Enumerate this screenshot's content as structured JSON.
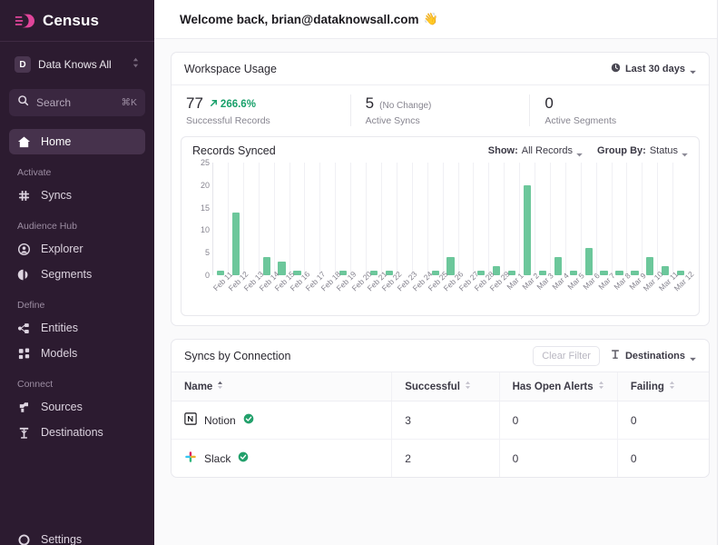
{
  "sidebar": {
    "brand": {
      "name": "Census",
      "logo_icon": "census-logo-icon",
      "color": "#e0459a"
    },
    "workspace": {
      "initial": "D",
      "name": "Data Knows All"
    },
    "search": {
      "placeholder": "Search",
      "shortcut": "⌘K"
    },
    "home": {
      "label": "Home",
      "icon": "home-icon"
    },
    "groups": [
      {
        "title": "Activate",
        "items": [
          {
            "label": "Syncs",
            "icon": "syncs-icon"
          }
        ]
      },
      {
        "title": "Audience Hub",
        "items": [
          {
            "label": "Explorer",
            "icon": "explorer-icon"
          },
          {
            "label": "Segments",
            "icon": "segments-icon"
          }
        ]
      },
      {
        "title": "Define",
        "items": [
          {
            "label": "Entities",
            "icon": "entities-icon"
          },
          {
            "label": "Models",
            "icon": "models-icon"
          }
        ]
      },
      {
        "title": "Connect",
        "items": [
          {
            "label": "Sources",
            "icon": "sources-icon"
          },
          {
            "label": "Destinations",
            "icon": "destinations-icon"
          }
        ]
      }
    ],
    "settings": {
      "label": "Settings",
      "icon": "gear-icon"
    }
  },
  "header": {
    "welcome": "Welcome back, brian@dataknowsall.com",
    "wave_emoji": "👋"
  },
  "workspace_usage": {
    "title": "Workspace Usage",
    "range": {
      "label": "Last 30 days",
      "icon": "clock-icon"
    },
    "stats": [
      {
        "value": "77",
        "delta": "266.6%",
        "delta_icon": "arrow-up-right-icon",
        "delta_color": "#18a06a",
        "note": "",
        "label": "Successful Records"
      },
      {
        "value": "5",
        "delta": "",
        "note": "(No Change)",
        "label": "Active Syncs"
      },
      {
        "value": "0",
        "delta": "",
        "note": "",
        "label": "Active Segments"
      }
    ]
  },
  "records_synced": {
    "title": "Records Synced",
    "controls": [
      {
        "label": "Show:",
        "value": "All Records"
      },
      {
        "label": "Group By:",
        "value": "Status"
      }
    ]
  },
  "chart_data": {
    "type": "bar",
    "title": "Records Synced",
    "xlabel": "",
    "ylabel": "",
    "ylim": [
      0,
      25
    ],
    "yticks": [
      0,
      5,
      10,
      15,
      20,
      25
    ],
    "grid": true,
    "legend": "none",
    "series_color": "#6cc79b",
    "categories": [
      "Feb 11",
      "Feb 12",
      "Feb 13",
      "Feb 14",
      "Feb 15",
      "Feb 16",
      "Feb 17",
      "Feb 18",
      "Feb 19",
      "Feb 20",
      "Feb 21",
      "Feb 22",
      "Feb 23",
      "Feb 24",
      "Feb 25",
      "Feb 26",
      "Feb 27",
      "Feb 28",
      "Feb 29",
      "Mar 1",
      "Mar 2",
      "Mar 3",
      "Mar 4",
      "Mar 5",
      "Mar 6",
      "Mar 7",
      "Mar 8",
      "Mar 9",
      "Mar 10",
      "Mar 11",
      "Mar 12"
    ],
    "values": [
      1,
      14,
      0,
      4,
      3,
      1,
      0,
      0,
      1,
      0,
      1,
      1,
      0,
      0,
      1,
      4,
      0,
      1,
      2,
      1,
      20,
      1,
      4,
      1,
      6,
      1,
      1,
      1,
      4,
      2,
      1
    ]
  },
  "syncs_by_connection": {
    "title": "Syncs by Connection",
    "clear_filter": "Clear Filter",
    "destinations": {
      "label": "Destinations",
      "icon": "destinations-icon"
    },
    "columns": [
      "Name",
      "Successful",
      "Has Open Alerts",
      "Failing"
    ],
    "rows": [
      {
        "name": "Notion",
        "icon": "notion-icon",
        "status_icon": "check-circle-icon",
        "successful": "3",
        "alerts": "0",
        "failing": "0"
      },
      {
        "name": "Slack",
        "icon": "slack-icon",
        "status_icon": "check-circle-icon",
        "successful": "2",
        "alerts": "0",
        "failing": "0"
      }
    ]
  }
}
